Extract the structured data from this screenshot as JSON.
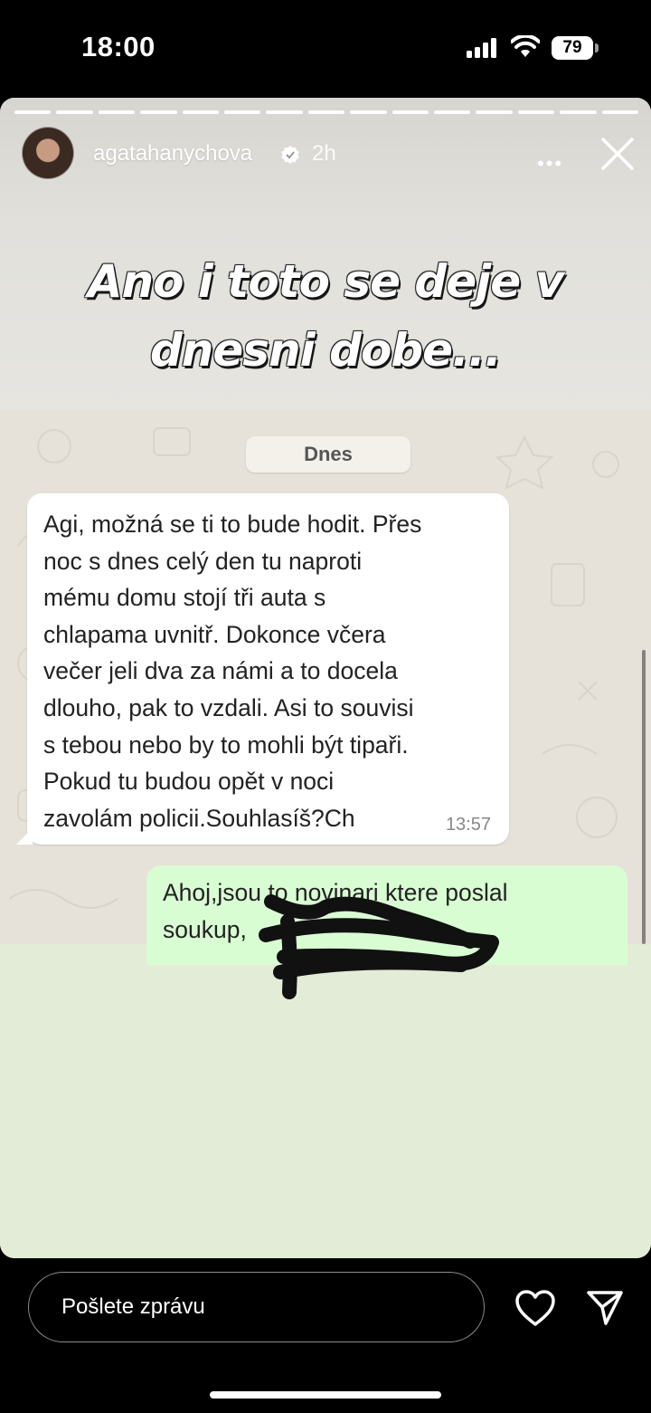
{
  "status_bar": {
    "time": "18:00",
    "battery": "79",
    "signal_icon": "cellular-signal-icon",
    "wifi_icon": "wifi-icon"
  },
  "story": {
    "progress_segments": 15,
    "username": "agatahanychova",
    "verified_icon": "verified-badge-icon",
    "time_ago": "2h",
    "more_icon": "•••",
    "close_icon": "close-icon",
    "caption_line1": "Ano i toto se deje v",
    "caption_line2": "dnesni dobe..."
  },
  "chat": {
    "date_chip": "Dnes",
    "incoming_message": "Agi, možná se ti to bude hodit. Přes\nnoc s dnes celý den tu naproti\nmému domu stojí tři auta s\nchlapama uvnitř. Dokonce včera\nvečer jeli dva za námi a to docela\ndlouho, pak to vzdali. Asi to souvisi\ns tebou nebo by to mohli být tipaři.\nPokud tu budou opět v noci\nzavolám policii.Souhlasíš?Ch",
    "incoming_time": "13:57",
    "outgoing_message": "Ahoj,jsou to novinari ktere poslal\nsoukup,"
  },
  "reply_bar": {
    "placeholder": "Pošlete zprávu",
    "heart_icon": "heart-icon",
    "send_icon": "send-icon"
  },
  "colors": {
    "incoming_bubble": "#ffffff",
    "outgoing_bubble": "#d9fdd3",
    "chat_background": "#e6e2da",
    "story_lower_background": "#e2ecd6"
  }
}
